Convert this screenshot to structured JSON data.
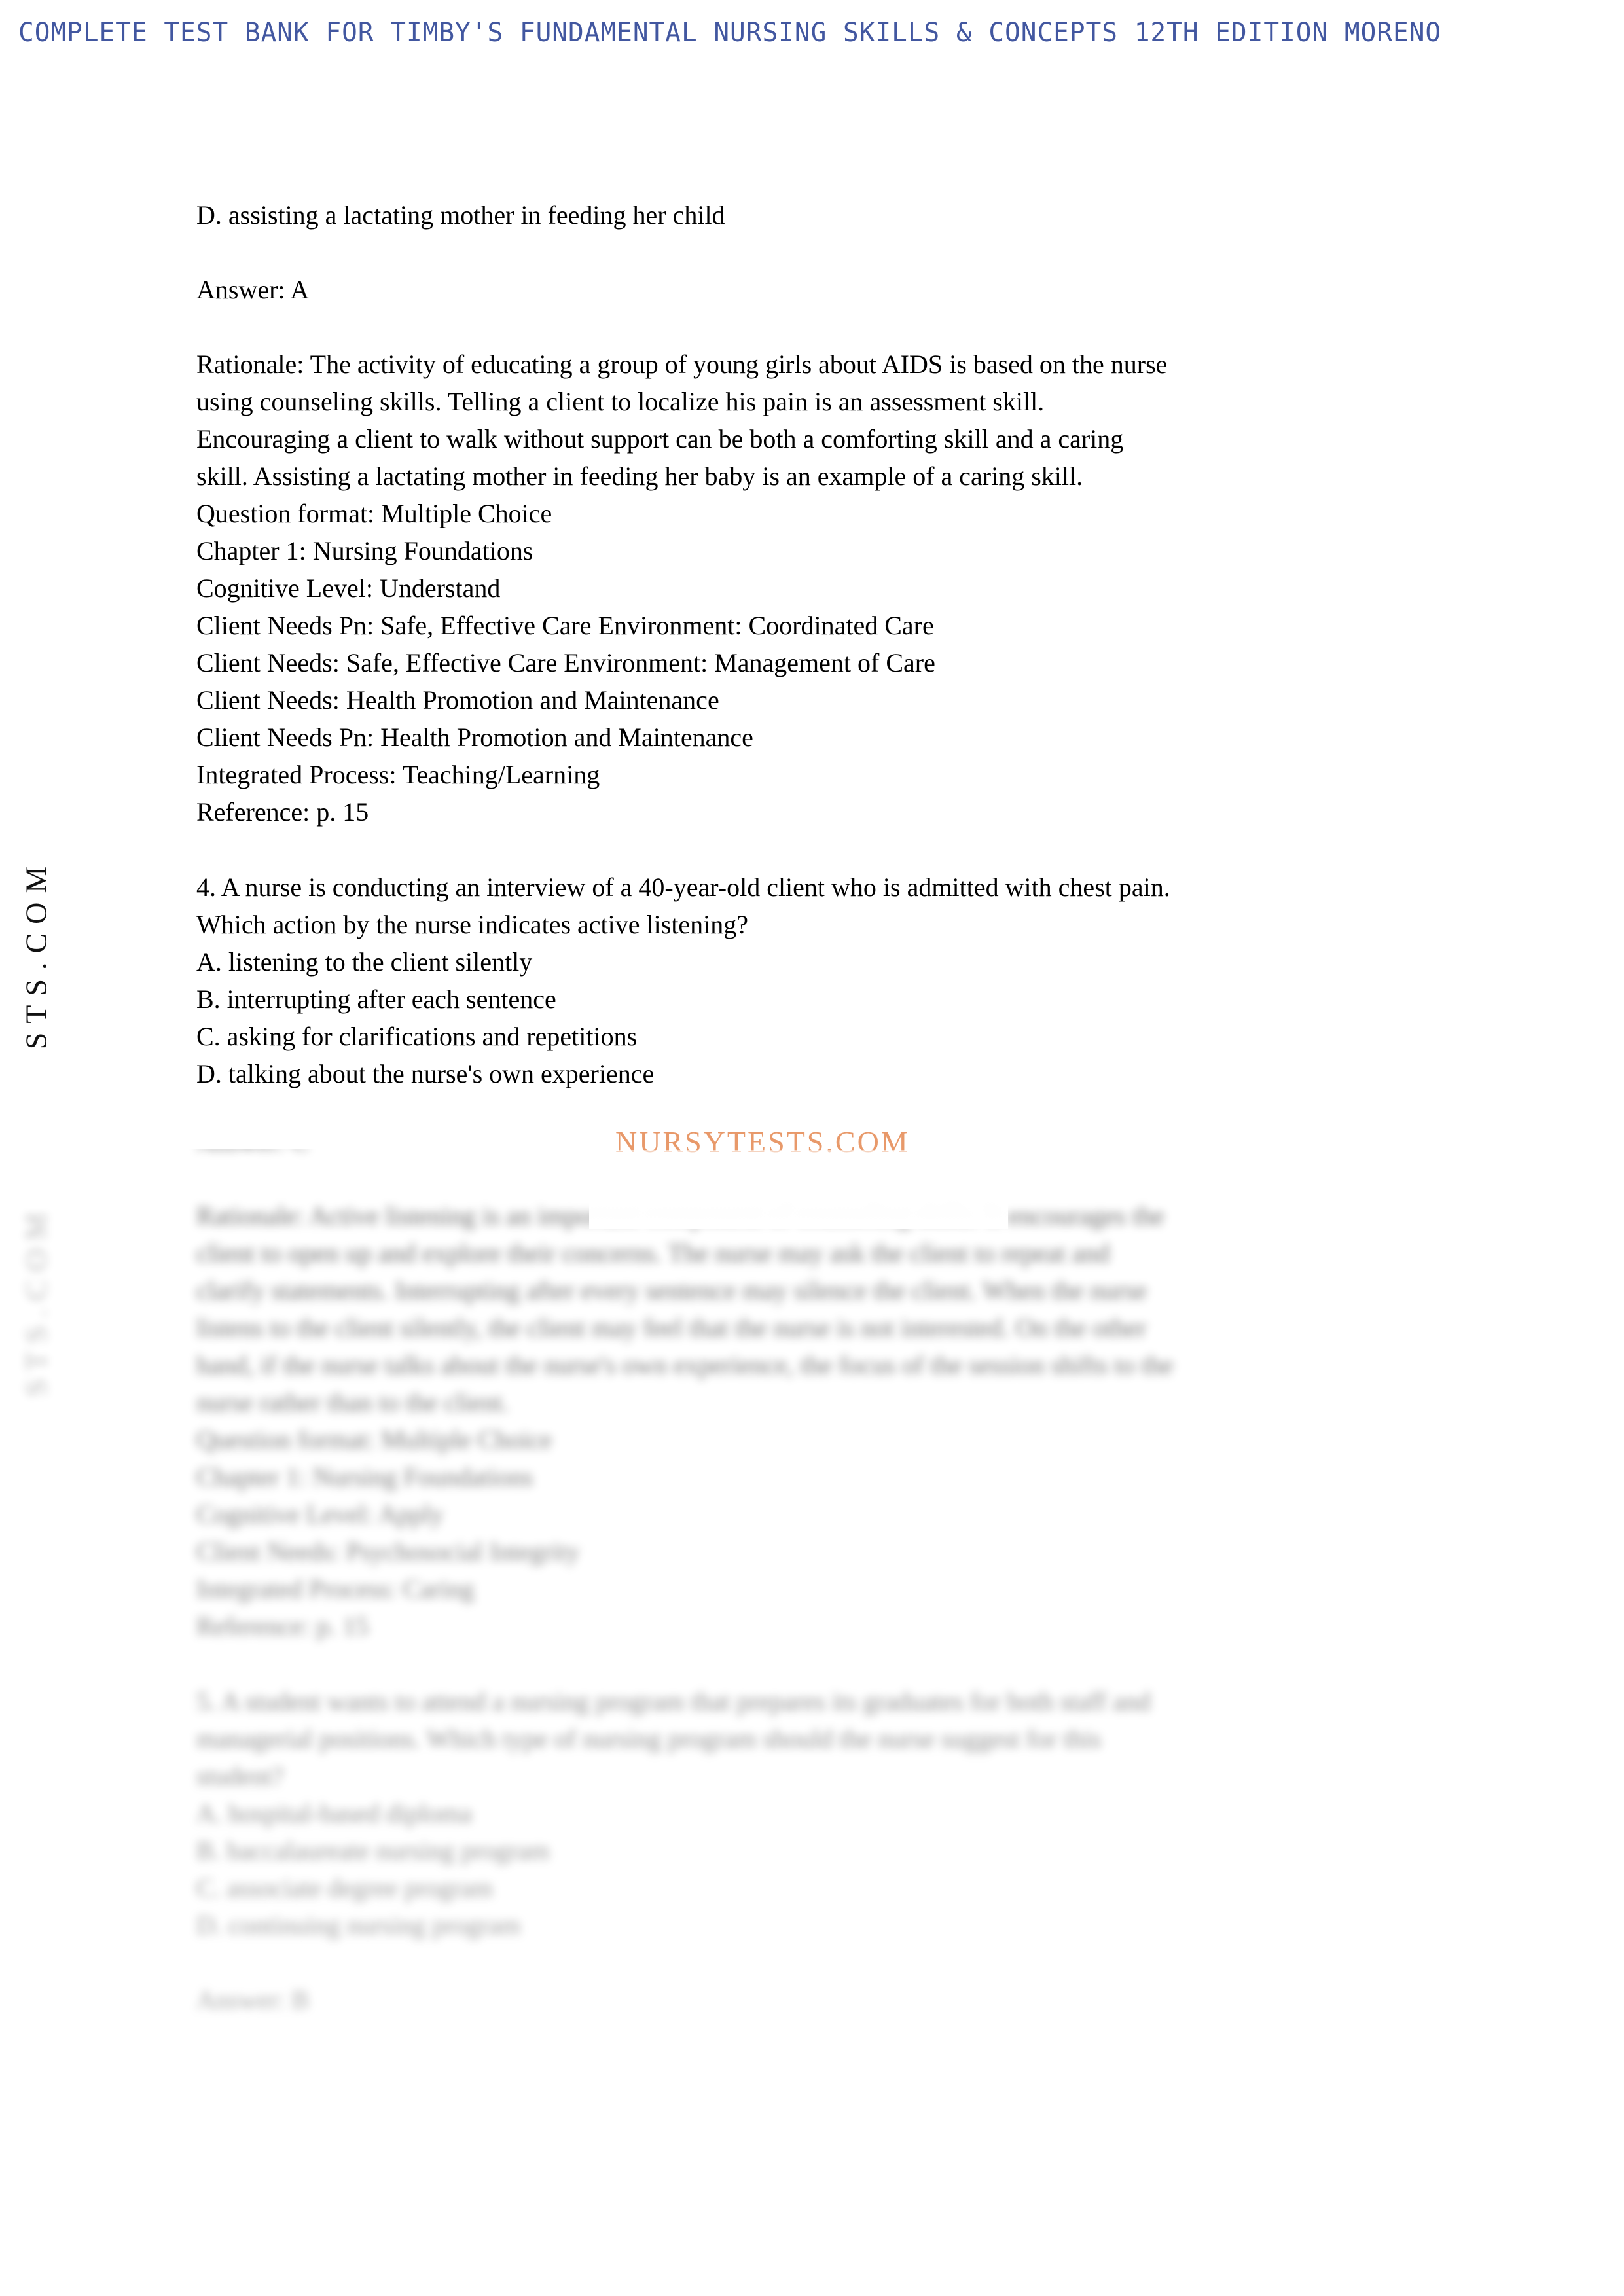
{
  "header": {
    "title": "COMPLETE TEST BANK FOR TIMBY'S FUNDAMENTAL NURSING SKILLS & CONCEPTS 12TH EDITION MORENO",
    "color": "#4257a0"
  },
  "watermarks": {
    "vertical_text": "NURSYTESTS.COM",
    "vertical_visible_text": "STS.COM",
    "center_text": "NURSYTESTS.COM",
    "center_color": "#e8996a"
  },
  "document": {
    "question3": {
      "option_d": "D. assisting a lactating mother in feeding her child",
      "answer": "Answer: A",
      "rationale_lines": [
        "Rationale: The activity of educating a group of young girls about AIDS is based on the nurse",
        "using counseling skills. Telling a client to localize his pain is an assessment skill.",
        "Encouraging a client to walk without support can be both a comforting skill and a caring",
        "skill. Assisting a lactating mother in feeding her baby is an example of a caring skill."
      ],
      "metadata_lines": [
        "Question format: Multiple Choice",
        "Chapter 1: Nursing Foundations",
        "Cognitive Level: Understand",
        "Client Needs Pn: Safe, Effective Care Environment: Coordinated Care",
        "Client Needs: Safe, Effective Care Environment: Management of Care",
        "Client Needs: Health Promotion and Maintenance",
        "Client Needs Pn: Health Promotion and Maintenance",
        "Integrated Process: Teaching/Learning",
        "Reference: p. 15"
      ]
    },
    "question4": {
      "stem_lines": [
        "4. A nurse is conducting an interview of a 40-year-old client who is admitted with chest pain.",
        "Which action by the nurse indicates active listening?"
      ],
      "options": [
        "A. listening to the client silently",
        "B. interrupting after each sentence",
        "C. asking for clarifications and repetitions",
        "D. talking about the nurse's own experience"
      ],
      "answer": "Answer: C",
      "rationale_lines": [
        "Rationale: Active listening is an important component of counseling skills. It encourages the",
        "client to open up and explore their concerns. The nurse may ask the client to repeat and",
        "clarify statements. Interrupting after every sentence may silence the client. When the nurse",
        "listens to the client silently, the client may feel that the nurse is not interested. On the other",
        "hand, if the nurse talks about the nurse's own experience, the focus of the session shifts to the",
        "nurse rather than to the client."
      ],
      "metadata_lines": [
        "Question format: Multiple Choice",
        "Chapter 1: Nursing Foundations",
        "Cognitive Level: Apply",
        "Client Needs: Psychosocial Integrity",
        "Integrated Process: Caring",
        "Reference: p. 15"
      ]
    },
    "question5": {
      "stem_lines": [
        "5. A student wants to attend a nursing program that prepares its graduates for both staff and",
        "managerial positions. Which type of nursing program should the nurse suggest for this",
        "student?"
      ],
      "options": [
        "A. hospital-based diploma",
        "B. baccalaureate nursing program",
        "C. associate degree program",
        "D. continuing nursing program"
      ],
      "answer": "Answer: B"
    }
  }
}
